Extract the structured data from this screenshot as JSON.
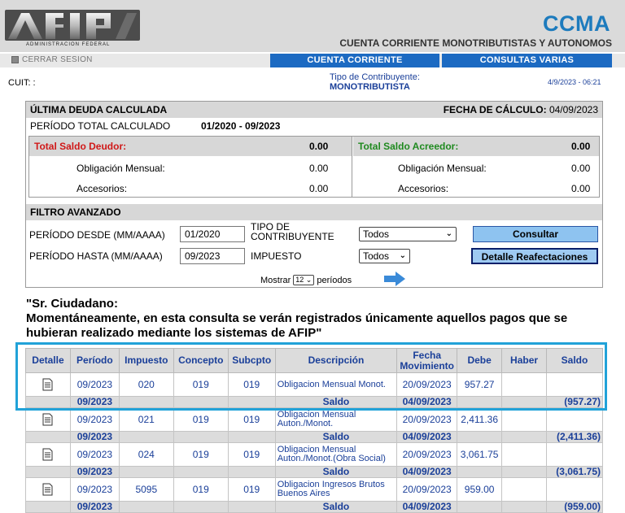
{
  "header": {
    "logo_sub": "ADMINISTRACION FEDERAL",
    "app_code": "CCMA",
    "app_title": "CUENTA CORRIENTE MONOTRIBUTISTAS Y AUTONOMOS",
    "logout": "CERRAR SESION",
    "tabs": [
      "CUENTA CORRIENTE",
      "CONSULTAS VARIAS"
    ]
  },
  "info": {
    "cuit_label": "CUIT: :",
    "tipo_label": "Tipo de Contribuyente:",
    "tipo_value": "MONOTRIBUTISTA",
    "datetime": "4/9/2023 - 06:21"
  },
  "summary": {
    "ultima_deuda": "ÚLTIMA DEUDA CALCULADA",
    "fecha_calculo_label": "FECHA DE CÁLCULO:",
    "fecha_calculo_value": "04/09/2023",
    "periodo_label": "PERÍODO TOTAL CALCULADO",
    "periodo_value": "01/2020 - 09/2023",
    "deudor_label": "Total Saldo Deudor:",
    "deudor_value": "0.00",
    "acreedor_label": "Total Saldo Acreedor:",
    "acreedor_value": "0.00",
    "obligacion_label": "Obligación Mensual:",
    "accesorios_label": "Accesorios:",
    "deudor_obligacion": "0.00",
    "deudor_accesorios": "0.00",
    "acreedor_obligacion": "0.00",
    "acreedor_accesorios": "0.00"
  },
  "filtro": {
    "title": "FILTRO AVANZADO",
    "desde_label": "PERÍODO DESDE (MM/AAAA)",
    "desde_value": "01/2020",
    "hasta_label": "PERÍODO HASTA (MM/AAAA)",
    "hasta_value": "09/2023",
    "tipo_label_1": "TIPO DE",
    "tipo_label_2": "CONTRIBUYENTE",
    "tipo_value": "Todos",
    "impuesto_label": "IMPUESTO",
    "impuesto_value": "Todos",
    "consultar": "Consultar",
    "reafectaciones": "Detalle Reafectaciones"
  },
  "paging": {
    "mostrar": "Mostrar",
    "count": "12",
    "periodos": "períodos"
  },
  "notice": {
    "line1": "\"Sr. Ciudadano:",
    "line2": "Momentáneamente, en esta consulta se verán registrados únicamente aquellos pagos que se hubieran realizado mediante los sistemas de AFIP\""
  },
  "table": {
    "headers": [
      "Detalle",
      "Período",
      "Impuesto",
      "Concepto",
      "Subcpto",
      "Descripción",
      "Fecha Movimiento",
      "Debe",
      "Haber",
      "Saldo"
    ],
    "saldo_label": "Saldo",
    "groups": [
      {
        "periodo": "09/2023",
        "impuesto": "020",
        "concepto": "019",
        "subcpto": "019",
        "descripcion": "Obligacion Mensual Monot.",
        "fecha": "20/09/2023",
        "debe": "957.27",
        "saldo_periodo": "09/2023",
        "saldo_fecha": "04/09/2023",
        "saldo": "(957.27)"
      },
      {
        "periodo": "09/2023",
        "impuesto": "021",
        "concepto": "019",
        "subcpto": "019",
        "descripcion": "Obligacion Mensual Auton./Monot.",
        "fecha": "20/09/2023",
        "debe": "2,411.36",
        "saldo_periodo": "09/2023",
        "saldo_fecha": "04/09/2023",
        "saldo": "(2,411.36)"
      },
      {
        "periodo": "09/2023",
        "impuesto": "024",
        "concepto": "019",
        "subcpto": "019",
        "descripcion": "Obligacion Mensual Auton./Monot.(Obra Social)",
        "fecha": "20/09/2023",
        "debe": "3,061.75",
        "saldo_periodo": "09/2023",
        "saldo_fecha": "04/09/2023",
        "saldo": "(3,061.75)"
      },
      {
        "periodo": "09/2023",
        "impuesto": "5095",
        "concepto": "019",
        "subcpto": "019",
        "descripcion": "Obligacion Ingresos Brutos Buenos Aires",
        "fecha": "20/09/2023",
        "debe": "959.00",
        "saldo_periodo": "09/2023",
        "saldo_fecha": "04/09/2023",
        "saldo": "(959.00)"
      }
    ]
  },
  "colors": {
    "nav_blue": "#1c6ac2",
    "link_blue": "#1a3f99",
    "debt_red": "#d01818",
    "credit_green": "#1f8a1f",
    "highlight": "#21a2d8"
  }
}
